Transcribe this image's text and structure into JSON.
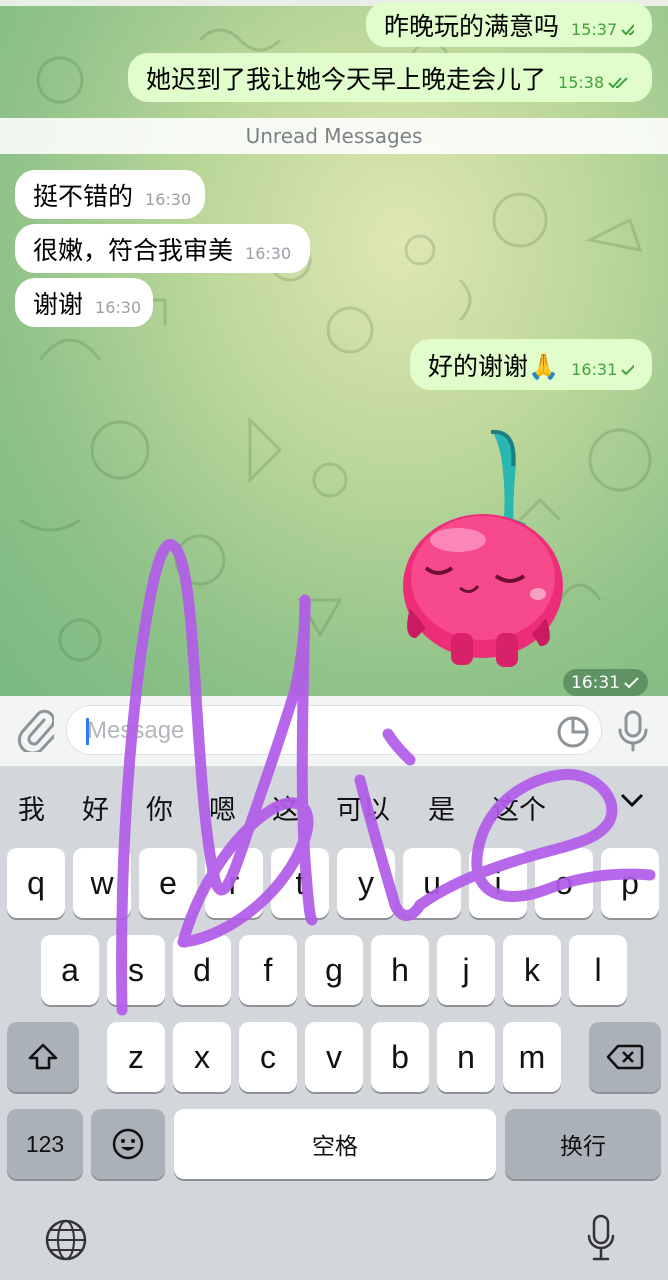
{
  "messages": [
    {
      "text": "昨晚玩的满意吗",
      "time": "15:37",
      "direction": "out"
    },
    {
      "text": "她迟到了我让她今天早上晚走会儿了",
      "time": "15:38",
      "direction": "out"
    },
    {
      "text": "挺不错的",
      "time": "16:30",
      "direction": "in"
    },
    {
      "text": "很嫩，符合我审美",
      "time": "16:30",
      "direction": "in"
    },
    {
      "text": "谢谢",
      "time": "16:30",
      "direction": "in"
    },
    {
      "text": "好的谢谢🙏",
      "time": "16:31",
      "direction": "out"
    }
  ],
  "unread_label": "Unread Messages",
  "sticker": {
    "icon": "cherry-sticker",
    "time": "16:31"
  },
  "composer": {
    "placeholder": "Message"
  },
  "keyboard": {
    "candidates": [
      "我",
      "好",
      "你",
      "嗯",
      "这",
      "可以",
      "是",
      "这个"
    ],
    "row1": [
      "q",
      "w",
      "e",
      "r",
      "t",
      "y",
      "u",
      "i",
      "o",
      "p"
    ],
    "row2": [
      "a",
      "s",
      "d",
      "f",
      "g",
      "h",
      "j",
      "k",
      "l"
    ],
    "row3": [
      "z",
      "x",
      "c",
      "v",
      "b",
      "n",
      "m"
    ],
    "numbers_label": "123",
    "space_label": "空格",
    "return_label": "换行"
  },
  "colors": {
    "outgoing_bubble": "#e1fdcb",
    "incoming_bubble": "#ffffff",
    "check": "#41a33e",
    "scribble": "#b25ce8"
  }
}
